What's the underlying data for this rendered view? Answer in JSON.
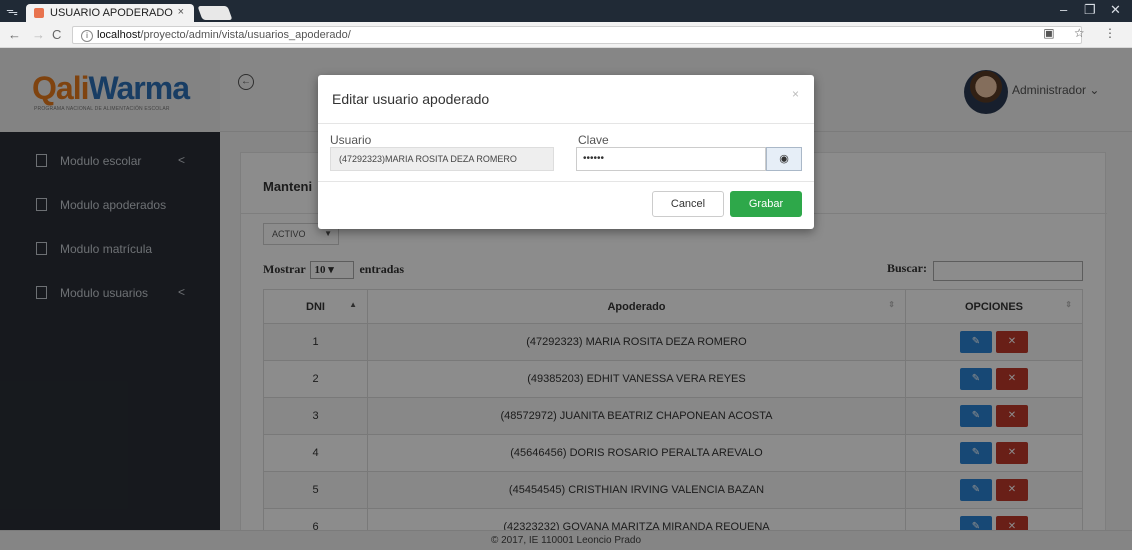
{
  "browser": {
    "tab_title": "USUARIO APODERADO",
    "tab_close": "×",
    "url_host": "localhost",
    "url_path": "/proyecto/admin/vista/usuarios_apoderado/"
  },
  "header": {
    "logo_part1": "Qali",
    "logo_part2": "Warma",
    "logo_subtitle": "PROGRAMA NACIONAL DE ALIMENTACIÓN ESCOLAR",
    "user_name": "Administrador ⌄"
  },
  "sidebar": {
    "items": [
      {
        "label": "Modulo escolar",
        "chevron": "<"
      },
      {
        "label": "Modulo apoderados",
        "chevron": ""
      },
      {
        "label": "Modulo matrícula",
        "chevron": ""
      },
      {
        "label": "Modulo usuarios",
        "chevron": "<"
      }
    ]
  },
  "panel": {
    "title": "Manteni",
    "status_value": "ACTIVO",
    "show_label": "Mostrar",
    "show_value": "10",
    "entries_label": "entradas",
    "search_label": "Buscar:",
    "columns": [
      "DNI",
      "Apoderado",
      "OPCIONES"
    ],
    "rows": [
      {
        "dni": "1",
        "apoderado": "(47292323) MARIA ROSITA DEZA ROMERO"
      },
      {
        "dni": "2",
        "apoderado": "(49385203) EDHIT VANESSA VERA REYES"
      },
      {
        "dni": "3",
        "apoderado": "(48572972) JUANITA BEATRIZ CHAPONEAN ACOSTA"
      },
      {
        "dni": "4",
        "apoderado": "(45646456) DORIS ROSARIO PERALTA AREVALO"
      },
      {
        "dni": "5",
        "apoderado": "(45454545) CRISTHIAN IRVING VALENCIA BAZAN"
      },
      {
        "dni": "6",
        "apoderado": "(42323232) GOVANA MARITZA MIRANDA REQUENA"
      }
    ]
  },
  "footer": {
    "text": "© 2017, IE 110001 Leoncio Prado"
  },
  "modal": {
    "title": "Editar usuario apoderado",
    "close": "×",
    "user_label": "Usuario",
    "user_value": "(47292323)MARIA ROSITA DEZA ROMERO",
    "pass_label": "Clave",
    "pass_value": "••••••",
    "cancel_label": "Cancel",
    "save_label": "Grabar"
  },
  "colors": {
    "save": "#2ea84a",
    "edit": "#2a84d6",
    "delete": "#c0392b",
    "logo_orange": "#e77a1c",
    "logo_blue": "#2c6fb6"
  }
}
